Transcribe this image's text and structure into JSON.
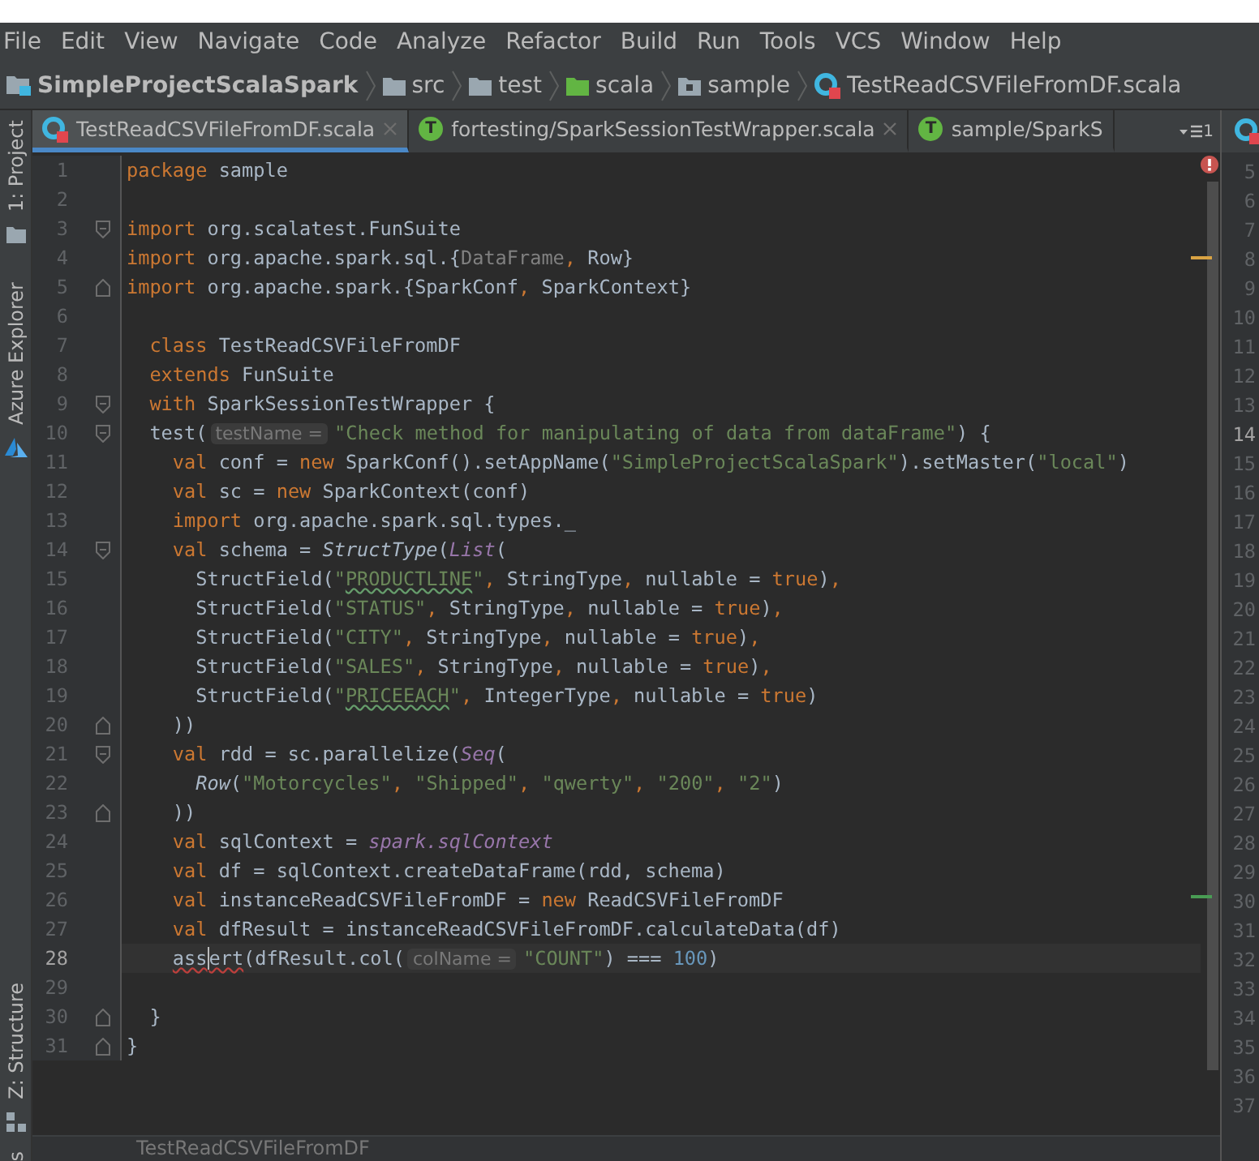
{
  "menu": [
    "File",
    "Edit",
    "View",
    "Navigate",
    "Code",
    "Analyze",
    "Refactor",
    "Build",
    "Run",
    "Tools",
    "VCS",
    "Window",
    "Help"
  ],
  "breadcrumb": [
    {
      "kind": "project",
      "label": "SimpleProjectScalaSpark"
    },
    {
      "kind": "folder",
      "label": "src"
    },
    {
      "kind": "folder",
      "label": "test"
    },
    {
      "kind": "source-folder",
      "label": "scala"
    },
    {
      "kind": "package",
      "label": "sample"
    },
    {
      "kind": "scala-class",
      "label": "TestReadCSVFileFromDF.scala"
    }
  ],
  "tool_strip": {
    "top": [
      {
        "kind": "project",
        "label": "1: Project"
      },
      {
        "kind": "azure",
        "label": "Azure Explorer"
      }
    ],
    "bottom": [
      {
        "kind": "structure",
        "label": "Z: Structure"
      },
      {
        "kind": "none",
        "label": "s"
      }
    ]
  },
  "tabs": [
    {
      "kind": "class",
      "label": "TestReadCSVFileFromDF.scala",
      "selected": true,
      "closable": true
    },
    {
      "kind": "trait",
      "badge": "T",
      "label": "fortesting/SparkSessionTestWrapper.scala",
      "selected": false,
      "closable": true
    },
    {
      "kind": "trait",
      "badge": "T",
      "label": "sample/SparkS",
      "selected": false,
      "closable": false
    }
  ],
  "hidden_tabs": "1",
  "editor": {
    "markers": [
      {
        "kind": "error"
      },
      {
        "kind": "warning"
      },
      {
        "kind": "change"
      }
    ],
    "lines": [
      {
        "number": "1",
        "tokens": [
          {
            "kind": "kw",
            "text": "package"
          },
          {
            "kind": "plain",
            "text": " sample"
          }
        ]
      },
      {
        "number": "2"
      },
      {
        "number": "3",
        "kind": "fold-start",
        "tokens": [
          {
            "kind": "kw",
            "text": "import"
          },
          {
            "kind": "plain",
            "text": " org.scalatest.FunSuite"
          }
        ]
      },
      {
        "number": "4",
        "tokens": [
          {
            "kind": "kw",
            "text": "import"
          },
          {
            "kind": "plain",
            "text": " org.apache.spark.sql.{"
          },
          {
            "kind": "unused",
            "text": "DataFrame"
          },
          {
            "kind": "kw",
            "text": ","
          },
          {
            "kind": "plain",
            "text": " Row}"
          }
        ]
      },
      {
        "number": "5",
        "kind": "fold-end",
        "tokens": [
          {
            "kind": "kw",
            "text": "import"
          },
          {
            "kind": "plain",
            "text": " org.apache.spark.{SparkConf"
          },
          {
            "kind": "kw",
            "text": ","
          },
          {
            "kind": "plain",
            "text": " SparkContext}"
          }
        ]
      },
      {
        "number": "6"
      },
      {
        "number": "7",
        "tokens": [
          {
            "kind": "kw",
            "text": "  class"
          },
          {
            "kind": "plain",
            "text": " TestReadCSVFileFromDF"
          }
        ]
      },
      {
        "number": "8",
        "tokens": [
          {
            "kind": "kw",
            "text": "  extends"
          },
          {
            "kind": "plain",
            "text": " FunSuite"
          }
        ]
      },
      {
        "number": "9",
        "kind": "fold-start",
        "tokens": [
          {
            "kind": "kw",
            "text": "  with"
          },
          {
            "kind": "plain",
            "text": " SparkSessionTestWrapper {"
          }
        ]
      },
      {
        "number": "10",
        "kind": "fold-start",
        "tokens": [
          {
            "kind": "plain",
            "text": "  test("
          },
          {
            "kind": "hint",
            "text": "testName ="
          },
          {
            "kind": "str",
            "text": "\"Check method for manipulating of data from dataFrame\""
          },
          {
            "kind": "plain",
            "text": ") {"
          }
        ]
      },
      {
        "number": "11",
        "tokens": [
          {
            "kind": "kw",
            "text": "    val"
          },
          {
            "kind": "plain",
            "text": " conf = "
          },
          {
            "kind": "kw",
            "text": "new"
          },
          {
            "kind": "plain",
            "text": " SparkConf().setAppName("
          },
          {
            "kind": "str",
            "text": "\"SimpleProjectScalaSpark\""
          },
          {
            "kind": "plain",
            "text": ").setMaster("
          },
          {
            "kind": "str",
            "text": "\"local\""
          },
          {
            "kind": "plain",
            "text": ")"
          }
        ]
      },
      {
        "number": "12",
        "tokens": [
          {
            "kind": "kw",
            "text": "    val"
          },
          {
            "kind": "plain",
            "text": " sc = "
          },
          {
            "kind": "kw",
            "text": "new"
          },
          {
            "kind": "plain",
            "text": " SparkContext(conf)"
          }
        ]
      },
      {
        "number": "13",
        "tokens": [
          {
            "kind": "kw",
            "text": "    import"
          },
          {
            "kind": "plain",
            "text": " org.apache.spark.sql.types._"
          }
        ]
      },
      {
        "number": "14",
        "kind": "fold-start",
        "tokens": [
          {
            "kind": "kw",
            "text": "    val"
          },
          {
            "kind": "plain",
            "text": " schema = "
          },
          {
            "kind": "italic",
            "text": "StructType"
          },
          {
            "kind": "plain",
            "text": "("
          },
          {
            "kind": "member",
            "text": "List"
          },
          {
            "kind": "plain",
            "text": "("
          }
        ]
      },
      {
        "number": "15",
        "tokens": [
          {
            "kind": "plain",
            "text": "      StructField("
          },
          {
            "kind": "str",
            "text": "\""
          },
          {
            "kind": "typo",
            "text": "PRODUCTLINE"
          },
          {
            "kind": "str",
            "text": "\""
          },
          {
            "kind": "kw",
            "text": ","
          },
          {
            "kind": "plain",
            "text": " StringType"
          },
          {
            "kind": "kw",
            "text": ","
          },
          {
            "kind": "plain",
            "text": " nullable = "
          },
          {
            "kind": "kw",
            "text": "true"
          },
          {
            "kind": "plain",
            "text": ")"
          },
          {
            "kind": "kw",
            "text": ","
          }
        ]
      },
      {
        "number": "16",
        "tokens": [
          {
            "kind": "plain",
            "text": "      StructField("
          },
          {
            "kind": "str",
            "text": "\"STATUS\""
          },
          {
            "kind": "kw",
            "text": ","
          },
          {
            "kind": "plain",
            "text": " StringType"
          },
          {
            "kind": "kw",
            "text": ","
          },
          {
            "kind": "plain",
            "text": " nullable = "
          },
          {
            "kind": "kw",
            "text": "true"
          },
          {
            "kind": "plain",
            "text": ")"
          },
          {
            "kind": "kw",
            "text": ","
          }
        ]
      },
      {
        "number": "17",
        "tokens": [
          {
            "kind": "plain",
            "text": "      StructField("
          },
          {
            "kind": "str",
            "text": "\"CITY\""
          },
          {
            "kind": "kw",
            "text": ","
          },
          {
            "kind": "plain",
            "text": " StringType"
          },
          {
            "kind": "kw",
            "text": ","
          },
          {
            "kind": "plain",
            "text": " nullable = "
          },
          {
            "kind": "kw",
            "text": "true"
          },
          {
            "kind": "plain",
            "text": ")"
          },
          {
            "kind": "kw",
            "text": ","
          }
        ]
      },
      {
        "number": "18",
        "tokens": [
          {
            "kind": "plain",
            "text": "      StructField("
          },
          {
            "kind": "str",
            "text": "\"SALES\""
          },
          {
            "kind": "kw",
            "text": ","
          },
          {
            "kind": "plain",
            "text": " StringType"
          },
          {
            "kind": "kw",
            "text": ","
          },
          {
            "kind": "plain",
            "text": " nullable = "
          },
          {
            "kind": "kw",
            "text": "true"
          },
          {
            "kind": "plain",
            "text": ")"
          },
          {
            "kind": "kw",
            "text": ","
          }
        ]
      },
      {
        "number": "19",
        "tokens": [
          {
            "kind": "plain",
            "text": "      StructField("
          },
          {
            "kind": "str",
            "text": "\""
          },
          {
            "kind": "typo",
            "text": "PRICEEACH"
          },
          {
            "kind": "str",
            "text": "\""
          },
          {
            "kind": "kw",
            "text": ","
          },
          {
            "kind": "plain",
            "text": " IntegerType"
          },
          {
            "kind": "kw",
            "text": ","
          },
          {
            "kind": "plain",
            "text": " nullable = "
          },
          {
            "kind": "kw",
            "text": "true"
          },
          {
            "kind": "plain",
            "text": ")"
          }
        ]
      },
      {
        "number": "20",
        "kind": "fold-end",
        "tokens": [
          {
            "kind": "plain",
            "text": "    ))"
          }
        ]
      },
      {
        "number": "21",
        "kind": "fold-start",
        "tokens": [
          {
            "kind": "kw",
            "text": "    val"
          },
          {
            "kind": "plain",
            "text": " rdd = sc.parallelize("
          },
          {
            "kind": "member",
            "text": "Seq"
          },
          {
            "kind": "plain",
            "text": "("
          }
        ]
      },
      {
        "number": "22",
        "tokens": [
          {
            "kind": "italic",
            "text": "      Row"
          },
          {
            "kind": "plain",
            "text": "("
          },
          {
            "kind": "str",
            "text": "\"Motorcycles\""
          },
          {
            "kind": "kw",
            "text": ","
          },
          {
            "kind": "str",
            "text": " \"Shipped\""
          },
          {
            "kind": "kw",
            "text": ","
          },
          {
            "kind": "str",
            "text": " \"qwerty\""
          },
          {
            "kind": "kw",
            "text": ","
          },
          {
            "kind": "str",
            "text": " \"200\""
          },
          {
            "kind": "kw",
            "text": ","
          },
          {
            "kind": "str",
            "text": " \"2\""
          },
          {
            "kind": "plain",
            "text": ")"
          }
        ]
      },
      {
        "number": "23",
        "kind": "fold-end",
        "tokens": [
          {
            "kind": "plain",
            "text": "    ))"
          }
        ]
      },
      {
        "number": "24",
        "tokens": [
          {
            "kind": "kw",
            "text": "    val"
          },
          {
            "kind": "plain",
            "text": " sqlContext = "
          },
          {
            "kind": "member",
            "text": "spark.sqlContext"
          }
        ]
      },
      {
        "number": "25",
        "tokens": [
          {
            "kind": "kw",
            "text": "    val"
          },
          {
            "kind": "plain",
            "text": " df = sqlContext.createDataFrame(rdd, schema)"
          }
        ]
      },
      {
        "number": "26",
        "tokens": [
          {
            "kind": "kw",
            "text": "    val"
          },
          {
            "kind": "plain",
            "text": " instanceReadCSVFileFromDF = "
          },
          {
            "kind": "kw",
            "text": "new"
          },
          {
            "kind": "plain",
            "text": " ReadCSVFileFromDF"
          }
        ]
      },
      {
        "number": "27",
        "tokens": [
          {
            "kind": "kw",
            "text": "    val"
          },
          {
            "kind": "plain",
            "text": " dfResult = instanceReadCSVFileFromDF.calculateData(df)"
          }
        ]
      },
      {
        "number": "28",
        "current": true,
        "tokens": [
          {
            "kind": "error",
            "text": "    ass"
          },
          {
            "kind": "error-caret",
            "text": "ert"
          },
          {
            "kind": "plain",
            "text": "(dfResult.col("
          },
          {
            "kind": "hint",
            "text": "colName ="
          },
          {
            "kind": "str",
            "text": "\"COUNT\""
          },
          {
            "kind": "plain",
            "text": ") === "
          },
          {
            "kind": "num",
            "text": "100"
          },
          {
            "kind": "plain",
            "text": ")"
          }
        ]
      },
      {
        "number": "29"
      },
      {
        "number": "30",
        "kind": "fold-end",
        "tokens": [
          {
            "kind": "plain",
            "text": "  }"
          }
        ]
      },
      {
        "number": "31",
        "kind": "fold-end",
        "tokens": [
          {
            "kind": "plain",
            "text": "}"
          }
        ]
      }
    ]
  },
  "split": {
    "line_numbers": [
      {
        "text": "5",
        "current": false
      },
      {
        "text": "6",
        "current": false
      },
      {
        "text": "7",
        "current": false
      },
      {
        "text": "8",
        "current": false
      },
      {
        "text": "9",
        "current": false
      },
      {
        "text": "10",
        "current": false
      },
      {
        "text": "11",
        "current": false
      },
      {
        "text": "12",
        "current": false
      },
      {
        "text": "13",
        "current": false
      },
      {
        "text": "14",
        "current": true
      },
      {
        "text": "15",
        "current": false
      },
      {
        "text": "16",
        "current": false
      },
      {
        "text": "17",
        "current": false
      },
      {
        "text": "18",
        "current": false
      },
      {
        "text": "19",
        "current": false
      },
      {
        "text": "20",
        "current": false
      },
      {
        "text": "21",
        "current": false
      },
      {
        "text": "22",
        "current": false
      },
      {
        "text": "23",
        "current": false
      },
      {
        "text": "24",
        "current": false
      },
      {
        "text": "25",
        "current": false
      },
      {
        "text": "26",
        "current": false
      },
      {
        "text": "27",
        "current": false
      },
      {
        "text": "28",
        "current": false
      },
      {
        "text": "29",
        "current": false
      },
      {
        "text": "30",
        "current": false
      },
      {
        "text": "31",
        "current": false
      },
      {
        "text": "32",
        "current": false
      },
      {
        "text": "33",
        "current": false
      },
      {
        "text": "34",
        "current": false
      },
      {
        "text": "35",
        "current": false
      },
      {
        "text": "36",
        "current": false
      },
      {
        "text": "37",
        "current": false
      }
    ]
  },
  "footer": "TestReadCSVFileFromDF"
}
